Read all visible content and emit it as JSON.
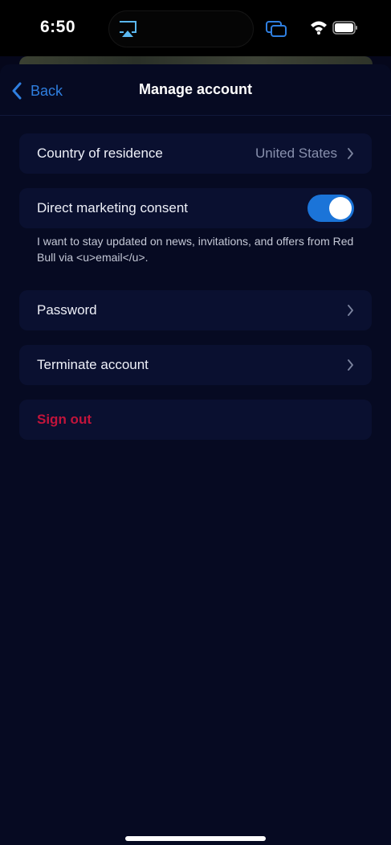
{
  "status_bar": {
    "time": "6:50"
  },
  "icons": {
    "airplay": "airplay-icon",
    "cast": "screen-mirror-icon",
    "wifi": "wifi-icon",
    "battery": "battery-icon",
    "back": "chevron-left-icon",
    "row_chevron": "chevron-right-icon"
  },
  "colors": {
    "accent": "#2f7fe0",
    "toggle_on": "#1b74d8",
    "destructive": "#c2143b",
    "background": "#060a22",
    "row_background": "#0a1030"
  },
  "nav": {
    "back_label": "Back",
    "title": "Manage account"
  },
  "settings": {
    "country": {
      "label": "Country of residence",
      "value": "United States"
    },
    "marketing": {
      "label": "Direct marketing consent",
      "enabled": true,
      "description": "I want to stay updated on news, invitations, and offers from Red Bull via <u>email</u>."
    },
    "password_label": "Password",
    "terminate_label": "Terminate account",
    "sign_out_label": "Sign out"
  }
}
